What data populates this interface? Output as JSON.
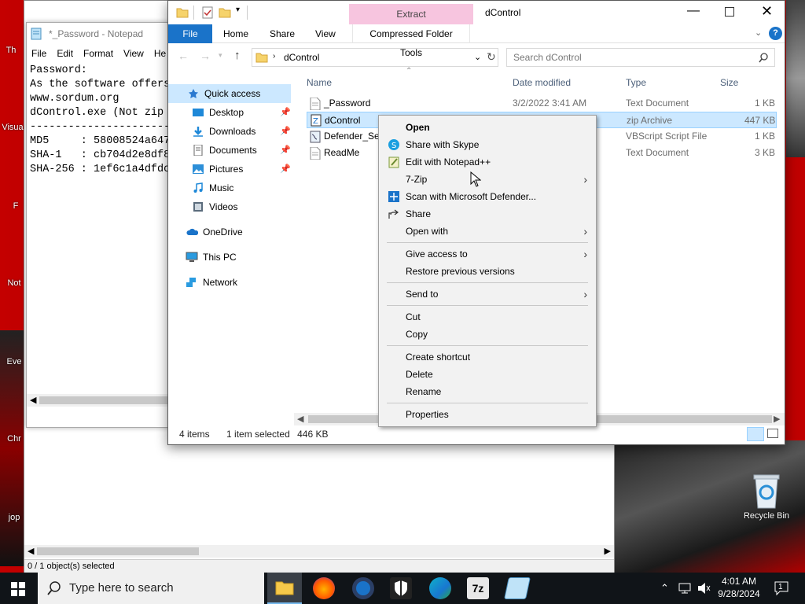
{
  "desktop": {
    "icons": [
      {
        "label": "Th"
      },
      {
        "label": "Visua"
      },
      {
        "label": "F"
      },
      {
        "label": "Not"
      },
      {
        "label": "Eve"
      },
      {
        "label": "Chr"
      },
      {
        "label": "jop"
      }
    ],
    "recycle_bin_label": "Recycle Bin"
  },
  "zip_window": {
    "status_text": "0 / 1 object(s) selected"
  },
  "notepad": {
    "title": "*_Password - Notepad",
    "menu": [
      "File",
      "Edit",
      "Format",
      "View",
      "He"
    ],
    "lines": [
      "Password:",
      "",
      "As the software offers",
      "",
      "www.sordum.org",
      "",
      "dControl.exe (Not zip",
      "-----------------------",
      "MD5     : 58008524a647",
      "SHA-1   : cb704d2e8df8",
      "SHA-256 : 1ef6c1a4dfdc"
    ]
  },
  "explorer": {
    "title": "dControl",
    "contextual_tab": "Extract",
    "tabs": [
      "File",
      "Home",
      "Share",
      "View",
      "Compressed Folder Tools"
    ],
    "address": "dControl",
    "search_placeholder": "Search dControl",
    "nav": [
      {
        "label": "Quick access",
        "icon": "star-icon"
      },
      {
        "label": "Desktop",
        "icon": "desktop-folder-icon",
        "pinned": true
      },
      {
        "label": "Downloads",
        "icon": "downloads-folder-icon",
        "pinned": true
      },
      {
        "label": "Documents",
        "icon": "documents-folder-icon",
        "pinned": true
      },
      {
        "label": "Pictures",
        "icon": "pictures-folder-icon",
        "pinned": true
      },
      {
        "label": "Music",
        "icon": "music-icon"
      },
      {
        "label": "Videos",
        "icon": "videos-icon"
      },
      {
        "label": "OneDrive",
        "icon": "onedrive-icon"
      },
      {
        "label": "This PC",
        "icon": "this-pc-icon"
      },
      {
        "label": "Network",
        "icon": "network-icon"
      }
    ],
    "columns": [
      "Name",
      "Date modified",
      "Type",
      "Size"
    ],
    "files": [
      {
        "name": "_Password",
        "date": "3/2/2022 3:41 AM",
        "type": "Text Document",
        "size": "1 KB"
      },
      {
        "name": "dControl",
        "date": "",
        "type": "zip Archive",
        "size": "447 KB"
      },
      {
        "name": "Defender_Set",
        "date": "",
        "type": "VBScript Script File",
        "size": "1 KB"
      },
      {
        "name": "ReadMe",
        "date": "",
        "type": "Text Document",
        "size": "3 KB"
      }
    ],
    "status": {
      "items": "4 items",
      "selected": "1 item selected",
      "size": "446 KB"
    }
  },
  "context_menu": {
    "items": [
      {
        "label": "Open",
        "bold": true
      },
      {
        "label": "Share with Skype",
        "icon": "skype-icon"
      },
      {
        "label": "Edit with Notepad++",
        "icon": "notepadpp-icon"
      },
      {
        "label": "7-Zip",
        "submenu": true
      },
      {
        "label": "Scan with Microsoft Defender...",
        "icon": "defender-icon"
      },
      {
        "label": "Share",
        "icon": "share-icon"
      },
      {
        "label": "Open with",
        "submenu": true
      },
      {
        "label": "Give access to",
        "submenu": true
      },
      {
        "label": "Restore previous versions"
      },
      {
        "label": "Send to",
        "submenu": true
      },
      {
        "label": "Cut"
      },
      {
        "label": "Copy"
      },
      {
        "label": "Create shortcut"
      },
      {
        "label": "Delete"
      },
      {
        "label": "Rename"
      },
      {
        "label": "Properties"
      }
    ]
  },
  "taskbar": {
    "search_placeholder": "Type here to search",
    "time": "4:01 AM",
    "date": "9/28/2024",
    "notification_count": "1"
  },
  "colors": {
    "accent": "#1a73c9",
    "selection": "#cce8ff",
    "extract_tab": "#f7c5df",
    "taskbar": "#101418"
  }
}
